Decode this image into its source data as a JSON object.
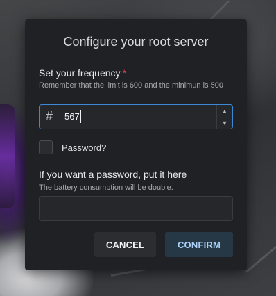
{
  "dialog": {
    "title": "Configure your root server",
    "frequency": {
      "label": "Set your frequency",
      "required_mark": "*",
      "hint": "Remember that the limit is 600 and the minimun is 500",
      "value": "567",
      "icon": "hash-icon",
      "stepper_up_icon": "chevron-up-icon",
      "stepper_down_icon": "chevron-down-icon"
    },
    "password_toggle": {
      "label": "Password?",
      "checked": false
    },
    "password": {
      "label": "If you want a password, put it here",
      "hint": "The battery consumption will be double.",
      "value": ""
    },
    "buttons": {
      "cancel": "CANCEL",
      "confirm": "CONFIRM"
    }
  },
  "colors": {
    "dialog_bg": "#1f2124",
    "focus_border": "#3a8ad8",
    "required": "#e0484c",
    "confirm_bg": "#263746",
    "confirm_text": "#a9d1f5"
  }
}
